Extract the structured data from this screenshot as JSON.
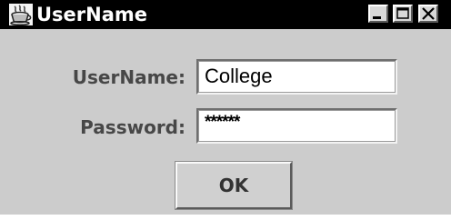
{
  "window": {
    "title": "UserName",
    "icon": "java-coffee-cup-icon",
    "controls": {
      "minimize_icon": "minimize-icon",
      "maximize_icon": "maximize-icon",
      "close_icon": "close-icon"
    }
  },
  "form": {
    "username_label": "UserName:",
    "username_value": "College",
    "password_label": "Password:",
    "password_value": "******"
  },
  "buttons": {
    "ok_label": "OK"
  },
  "colors": {
    "titlebar": "#000000",
    "window_background": "#cccccc",
    "field_background": "#ffffff",
    "label_text": "#474747"
  }
}
